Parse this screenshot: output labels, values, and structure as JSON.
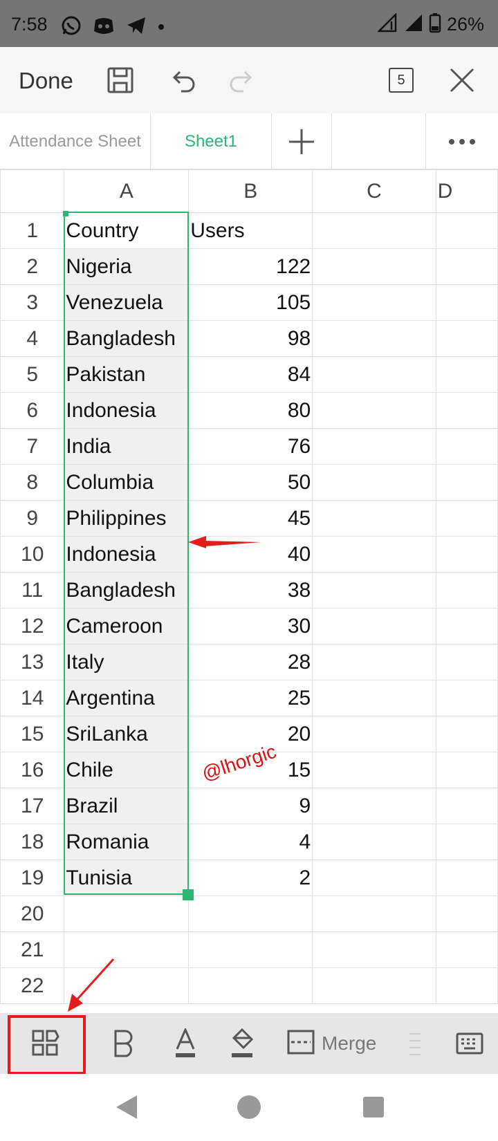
{
  "status": {
    "time": "7:58",
    "battery": "26%"
  },
  "toolbar": {
    "done_label": "Done",
    "tab_count": "5"
  },
  "sheet_tabs": [
    {
      "label": "Attendance Sheet"
    },
    {
      "label": "Sheet1"
    }
  ],
  "columns": [
    "A",
    "B",
    "C",
    "D"
  ],
  "rows": [
    {
      "num": "1",
      "a": "Country",
      "b": "Users"
    },
    {
      "num": "2",
      "a": "Nigeria",
      "b": "122"
    },
    {
      "num": "3",
      "a": "Venezuela",
      "b": "105"
    },
    {
      "num": "4",
      "a": "Bangladesh",
      "b": "98"
    },
    {
      "num": "5",
      "a": "Pakistan",
      "b": "84"
    },
    {
      "num": "6",
      "a": "Indonesia",
      "b": "80"
    },
    {
      "num": "7",
      "a": "India",
      "b": "76"
    },
    {
      "num": "8",
      "a": "Columbia",
      "b": "50"
    },
    {
      "num": "9",
      "a": "Philippines",
      "b": "45"
    },
    {
      "num": "10",
      "a": "Indonesia",
      "b": "40"
    },
    {
      "num": "11",
      "a": "Bangladesh",
      "b": "38"
    },
    {
      "num": "12",
      "a": "Cameroon",
      "b": "30"
    },
    {
      "num": "13",
      "a": "Italy",
      "b": "28"
    },
    {
      "num": "14",
      "a": "Argentina",
      "b": "25"
    },
    {
      "num": "15",
      "a": "SriLanka",
      "b": "20"
    },
    {
      "num": "16",
      "a": "Chile",
      "b": "15"
    },
    {
      "num": "17",
      "a": "Brazil",
      "b": "9"
    },
    {
      "num": "18",
      "a": "Romania",
      "b": "4"
    },
    {
      "num": "19",
      "a": "Tunisia",
      "b": "2"
    },
    {
      "num": "20",
      "a": "",
      "b": ""
    },
    {
      "num": "21",
      "a": "",
      "b": ""
    },
    {
      "num": "22",
      "a": "",
      "b": ""
    }
  ],
  "watermark": "@lhorgic",
  "bottom_toolbar": {
    "merge_label": "Merge"
  },
  "colors": {
    "accent": "#2bb673",
    "annotation": "#e31c1c"
  },
  "icons": [
    "save-icon",
    "undo-icon",
    "redo-icon",
    "close-icon",
    "add-sheet-icon",
    "more-icon",
    "grid-tools-icon",
    "bold-icon",
    "font-color-icon",
    "fill-color-icon",
    "border-icon",
    "keyboard-icon",
    "back-icon",
    "home-icon",
    "recents-icon"
  ]
}
